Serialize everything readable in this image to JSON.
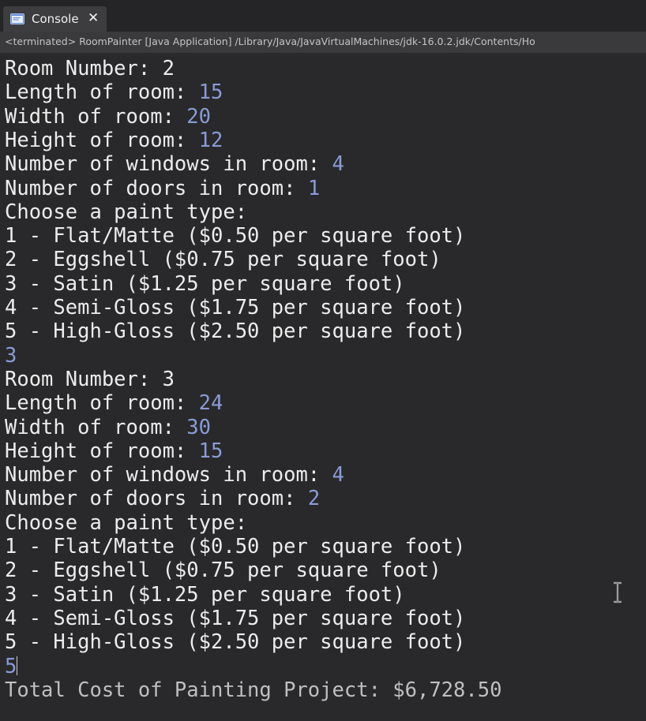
{
  "tab": {
    "label": "Console",
    "close_glyph": "✕",
    "icon": "console-icon"
  },
  "status": "<terminated> RoomPainter [Java Application] /Library/Java/JavaVirtualMachines/jdk-16.0.2.jdk/Contents/Ho",
  "console": {
    "lines": [
      {
        "text": "Room Number: 2",
        "input": ""
      },
      {
        "text": "Length of room: ",
        "input": "15"
      },
      {
        "text": "Width of room: ",
        "input": "20"
      },
      {
        "text": "Height of room: ",
        "input": "12"
      },
      {
        "text": "Number of windows in room: ",
        "input": "4"
      },
      {
        "text": "Number of doors in room: ",
        "input": "1"
      },
      {
        "text": "Choose a paint type:",
        "input": ""
      },
      {
        "text": "1 - Flat/Matte ($0.50 per square foot)",
        "input": ""
      },
      {
        "text": "2 - Eggshell ($0.75 per square foot)",
        "input": ""
      },
      {
        "text": "3 - Satin ($1.25 per square foot)",
        "input": ""
      },
      {
        "text": "4 - Semi-Gloss ($1.75 per square foot)",
        "input": ""
      },
      {
        "text": "5 - High-Gloss ($2.50 per square foot)",
        "input": ""
      },
      {
        "text": "",
        "input": "3"
      },
      {
        "text": "Room Number: 3",
        "input": ""
      },
      {
        "text": "Length of room: ",
        "input": "24"
      },
      {
        "text": "Width of room: ",
        "input": "30"
      },
      {
        "text": "Height of room: ",
        "input": "15"
      },
      {
        "text": "Number of windows in room: ",
        "input": "4"
      },
      {
        "text": "Number of doors in room: ",
        "input": "2"
      },
      {
        "text": "Choose a paint type:",
        "input": ""
      },
      {
        "text": "1 - Flat/Matte ($0.50 per square foot)",
        "input": ""
      },
      {
        "text": "2 - Eggshell ($0.75 per square foot)",
        "input": ""
      },
      {
        "text": "3 - Satin ($1.25 per square foot)",
        "input": ""
      },
      {
        "text": "4 - Semi-Gloss ($1.75 per square foot)",
        "input": ""
      },
      {
        "text": "5 - High-Gloss ($2.50 per square foot)",
        "input": ""
      },
      {
        "text": "",
        "input": "5",
        "cursor": true
      },
      {
        "text": "Total Cost of Painting Project: $6,728.50",
        "input": "",
        "total": true
      }
    ]
  },
  "colors": {
    "output": "#ececec",
    "input": "#8a9bd6",
    "background": "#29292b"
  }
}
